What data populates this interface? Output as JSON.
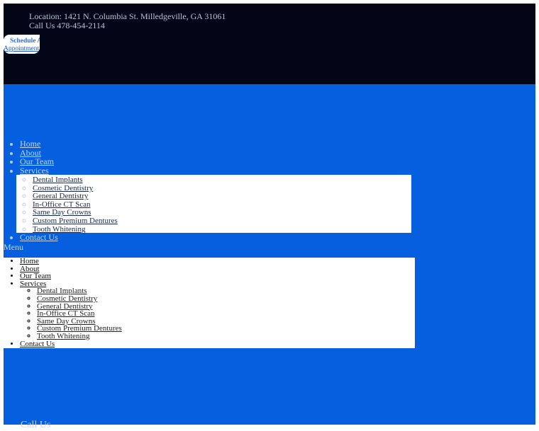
{
  "topbar": {
    "location": "Location: 1421 N. Columbia St. Milledgeville, GA 31061",
    "phone": "Call Us 478-454-2114",
    "schedule_back_label": "Schedule Ap",
    "schedule_front_label": "Appointment"
  },
  "nav": {
    "items": [
      "Home",
      "About",
      "Our Team",
      "Services"
    ],
    "services": [
      "Dental Implants",
      "Cosmetic Dentistry",
      "General Dentistry",
      "In-Office CT Scan",
      "Same Day Crowns",
      "Custom Premium Dentures",
      "Tooth Whitening"
    ],
    "contact": "Contact Us"
  },
  "menu_label": "Menu",
  "bottom_partial": "Call Us",
  "colors": {
    "topbar": "#030617",
    "brand_blue": "#055fde",
    "panel": "#ffffff"
  }
}
